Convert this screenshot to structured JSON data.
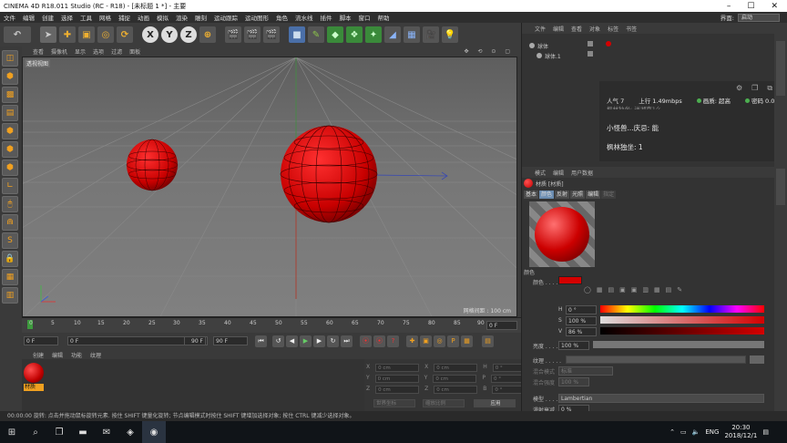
{
  "window": {
    "title": "CINEMA 4D R18.011 Studio (RC - R18) - [未标题 1 *] - 主要"
  },
  "menubar": {
    "items": [
      "文件",
      "编辑",
      "创建",
      "选择",
      "工具",
      "网格",
      "捕捉",
      "动画",
      "模拟",
      "渲染",
      "雕刻",
      "运动跟踪",
      "运动图形",
      "角色",
      "流水线",
      "插件",
      "脚本",
      "窗口",
      "帮助"
    ],
    "interface_label": "界面:",
    "interface_value": "启动"
  },
  "toolbar": {
    "axis_x": "X",
    "axis_y": "Y",
    "axis_z": "Z"
  },
  "viewport": {
    "menu": [
      "查看",
      "摄像机",
      "显示",
      "选项",
      "过滤",
      "面板"
    ],
    "label": "透视视图",
    "grid_info": "网格间距 : 100 cm"
  },
  "timeline": {
    "ticks": [
      "0",
      "5",
      "10",
      "15",
      "20",
      "25",
      "30",
      "35",
      "40",
      "45",
      "50",
      "55",
      "60",
      "65",
      "70",
      "75",
      "80",
      "85",
      "90"
    ],
    "frame_right": "0 F"
  },
  "transport": {
    "start_frame": "0 F",
    "current_frame": "0 F",
    "end_frame": "90 F",
    "max_frame": "90 F"
  },
  "material_manager": {
    "menu": [
      "创建",
      "编辑",
      "功能",
      "纹理"
    ],
    "material_name": "材质"
  },
  "coordinates": {
    "rows": [
      {
        "a": "X",
        "v1": "0 cm",
        "b": "X",
        "v2": "0 cm",
        "c": "H",
        "v3": "0 °"
      },
      {
        "a": "Y",
        "v1": "0 cm",
        "b": "Y",
        "v2": "0 cm",
        "c": "P",
        "v3": "0 °"
      },
      {
        "a": "Z",
        "v1": "0 cm",
        "b": "Z",
        "v2": "0 cm",
        "c": "B",
        "v3": "0 °"
      }
    ],
    "mode_world": "世界坐标",
    "mode_scale": "缩放比例",
    "apply": "应用"
  },
  "object_manager": {
    "menu": [
      "文件",
      "编辑",
      "查看",
      "对象",
      "标签",
      "书签"
    ],
    "objects": [
      {
        "name": "球体"
      },
      {
        "name": "球体.1"
      }
    ]
  },
  "overlay": {
    "popularity": "人气 7",
    "upload": "上行 1.49mbps",
    "quality_label": "画质: 超高",
    "mic_label": "密码 0.0%",
    "truncated": "枫林独坐: 送湖南1么",
    "line1": "小怪兽...庆忌: 能",
    "line2": "枫林独坐: 1"
  },
  "attribute_manager": {
    "menu": [
      "模式",
      "编辑",
      "用户数据"
    ],
    "title": "材质 [材质]",
    "tabs": [
      "基本",
      "颜色",
      "反射",
      "光照",
      "编辑",
      "指定"
    ],
    "section_color": "颜色",
    "color_label": "颜色 . . . . .",
    "h_label": "H",
    "h_value": "0 °",
    "s_label": "S",
    "s_value": "100 %",
    "v_label": "V",
    "v_value": "86 %",
    "brightness_label": "亮度 . . . . .",
    "brightness_value": "100 %",
    "texture_label": "纹理 . . . . .",
    "mix_mode_label": "混合模式",
    "mix_mode_value": "标准",
    "mix_strength_label": "混合强度",
    "mix_strength_value": "100 %",
    "model_label": "模型 . . . . .",
    "model_value": "Lambertian",
    "diffuse_label": "漫射衰减",
    "diffuse_value": "0 %",
    "diffuse_level_label": "漫射层级",
    "diffuse_level_value": "100 %",
    "colors": {
      "material_red": "#d40000",
      "accent_orange": "#f0a020"
    }
  },
  "statusbar": {
    "text": "00:00:00   旋转: 点击并拖动鼠标旋转元素. 按住 SHIFT 键量化旋转; 节点编辑模式时按住 SHIFT 键增加选择对象; 按住 CTRL 键减少选择对象。"
  },
  "taskbar": {
    "lang": "ENG",
    "time": "20:30",
    "date": "2018/12/1"
  }
}
